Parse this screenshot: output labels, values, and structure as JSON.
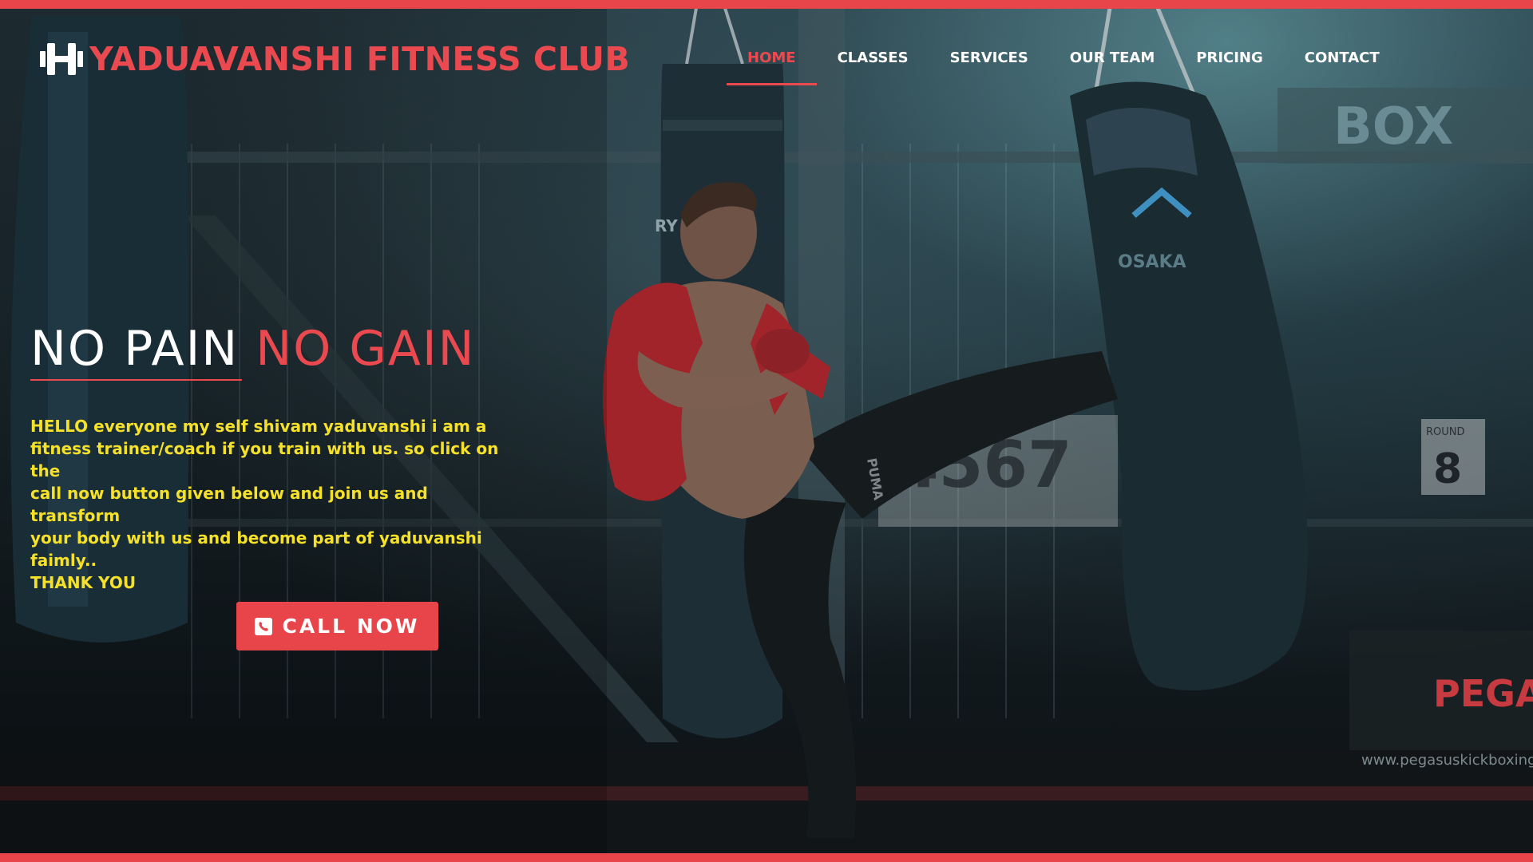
{
  "brand": {
    "name": "YADUAVANSHI FITNESS CLUB",
    "icon": "dumbbell-icon",
    "color": "#ea4a4f"
  },
  "nav": {
    "items": [
      {
        "label": "HOME",
        "active": true
      },
      {
        "label": "CLASSES",
        "active": false
      },
      {
        "label": "SERVICES",
        "active": false
      },
      {
        "label": "OUR TEAM",
        "active": false
      },
      {
        "label": "PRICING",
        "active": false
      },
      {
        "label": "CONTACT",
        "active": false
      }
    ]
  },
  "hero": {
    "title_white": "NO PAIN",
    "title_red": "NO GAIN",
    "lines": [
      "HELLO everyone my self shivam yaduvanshi i am a",
      "fitness trainer/coach if you train with us. so click on the",
      "call now button given below and join us and transform",
      "your body with us and become part of yaduvanshi",
      "faimly..",
      "THANK YOU"
    ],
    "text_color": "#f5e12a"
  },
  "cta": {
    "label": "CALL NOW",
    "icon": "phone-icon",
    "color": "#e8454b"
  },
  "background": {
    "description_icon": "gym-background-image",
    "bag_brand": "OSAKA",
    "bag_numbers": "4567",
    "round_label": "ROUND",
    "round_number": "8",
    "wall_sign": "BOX",
    "sponsor": "PEGA",
    "website": "www.pegasuskickboxing.co",
    "pants_brand": "PUMA",
    "pole_text": "RY"
  }
}
